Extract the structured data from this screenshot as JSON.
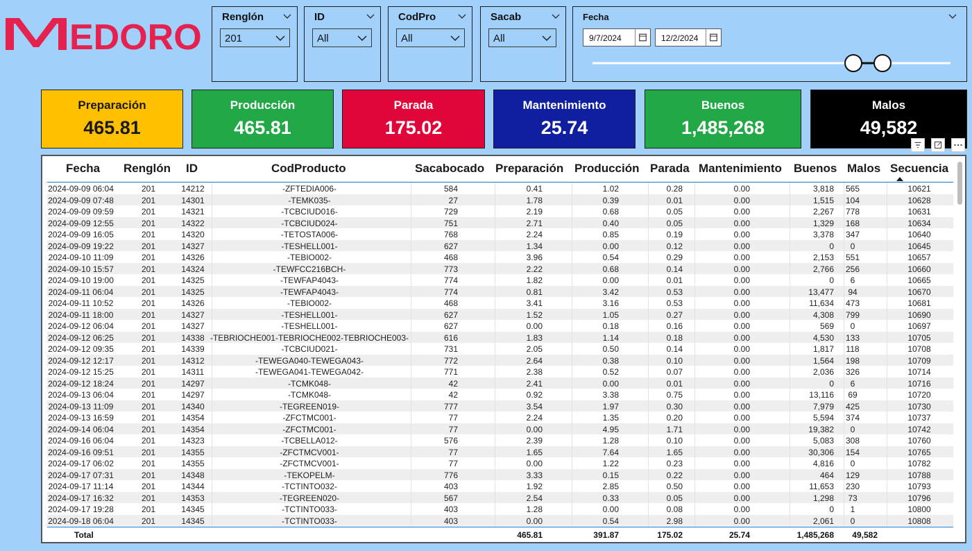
{
  "brand": {
    "logo_text": "MEDORO",
    "logo_color": "#e5224f"
  },
  "slicers": [
    {
      "title": "Renglón",
      "value": "201"
    },
    {
      "title": "ID",
      "value": "All"
    },
    {
      "title": "CodPro",
      "value": "All"
    },
    {
      "title": "Sacab",
      "value": "All"
    }
  ],
  "date_slicer": {
    "title": "Fecha",
    "start": "9/7/2024",
    "end": "12/2/2024"
  },
  "kpis": [
    {
      "label": "Preparación",
      "value": "465.81",
      "bg": "#ffc000",
      "fg": "#1a1a1a"
    },
    {
      "label": "Producción",
      "value": "465.81",
      "bg": "#22a846",
      "fg": "#ffffff"
    },
    {
      "label": "Parada",
      "value": "175.02",
      "bg": "#e0063a",
      "fg": "#ffffff"
    },
    {
      "label": "Mantenimiento",
      "value": "25.74",
      "bg": "#0f1fa0",
      "fg": "#ffffff"
    },
    {
      "label": "Buenos",
      "value": "1,485,268",
      "bg": "#22a846",
      "fg": "#ffffff"
    },
    {
      "label": "Malos",
      "value": "49,582",
      "bg": "#000000",
      "fg": "#ffffff"
    }
  ],
  "table": {
    "headers": [
      "Fecha",
      "Renglón",
      "ID",
      "CodProducto",
      "Sacabocado",
      "Preparación",
      "Producción",
      "Parada",
      "Mantenimiento",
      "Buenos",
      "Malos",
      "Secuencia"
    ],
    "rows": [
      [
        "2024-09-09 06:04",
        "201",
        "14212",
        "-ZFTEDIA006-",
        "584",
        "0.41",
        "1.02",
        "0.28",
        "0.00",
        "3,818",
        "565",
        "10621"
      ],
      [
        "2024-09-09 07:48",
        "201",
        "14301",
        "-TEMK035-",
        "27",
        "1.78",
        "0.39",
        "0.01",
        "0.00",
        "1,515",
        "104",
        "10628"
      ],
      [
        "2024-09-09 09:59",
        "201",
        "14321",
        "-TCBCIUD016-",
        "729",
        "2.19",
        "0.68",
        "0.05",
        "0.00",
        "2,267",
        "778",
        "10631"
      ],
      [
        "2024-09-09 12:55",
        "201",
        "14322",
        "-TCBCIUD024-",
        "751",
        "2.71",
        "0.40",
        "0.05",
        "0.00",
        "1,329",
        "168",
        "10634"
      ],
      [
        "2024-09-09 16:05",
        "201",
        "14320",
        "-TETOSTA006-",
        "768",
        "2.24",
        "0.85",
        "0.19",
        "0.00",
        "3,378",
        "347",
        "10640"
      ],
      [
        "2024-09-09 19:22",
        "201",
        "14327",
        "-TESHELL001-",
        "627",
        "1.34",
        "0.00",
        "0.12",
        "0.00",
        "0",
        "0",
        "10645"
      ],
      [
        "2024-09-10 11:09",
        "201",
        "14326",
        "-TEBIO002-",
        "468",
        "3.96",
        "0.54",
        "0.29",
        "0.00",
        "2,153",
        "551",
        "10657"
      ],
      [
        "2024-09-10 15:57",
        "201",
        "14324",
        "-TEWFCC216BCH-",
        "773",
        "2.22",
        "0.68",
        "0.14",
        "0.00",
        "2,766",
        "256",
        "10660"
      ],
      [
        "2024-09-10 19:00",
        "201",
        "14325",
        "-TEWFAP4043-",
        "774",
        "1.82",
        "0.00",
        "0.01",
        "0.00",
        "0",
        "6",
        "10665"
      ],
      [
        "2024-09-11 06:04",
        "201",
        "14325",
        "-TEWFAP4043-",
        "774",
        "0.81",
        "3.42",
        "0.53",
        "0.00",
        "13,477",
        "94",
        "10670"
      ],
      [
        "2024-09-11 10:52",
        "201",
        "14326",
        "-TEBIO002-",
        "468",
        "3.41",
        "3.16",
        "0.53",
        "0.00",
        "11,634",
        "473",
        "10681"
      ],
      [
        "2024-09-11 18:00",
        "201",
        "14327",
        "-TESHELL001-",
        "627",
        "1.52",
        "1.05",
        "0.27",
        "0.00",
        "4,308",
        "799",
        "10690"
      ],
      [
        "2024-09-12 06:04",
        "201",
        "14327",
        "-TESHELL001-",
        "627",
        "0.00",
        "0.18",
        "0.16",
        "0.00",
        "569",
        "0",
        "10697"
      ],
      [
        "2024-09-12 06:25",
        "201",
        "14338",
        "-TEBRIOCHE001-TEBRIOCHE002-TEBRIOCHE003-",
        "616",
        "1.83",
        "1.14",
        "0.18",
        "0.00",
        "4,530",
        "133",
        "10705"
      ],
      [
        "2024-09-12 09:35",
        "201",
        "14339",
        "-TCBCIUD021-",
        "731",
        "2.05",
        "0.50",
        "0.14",
        "0.00",
        "1,817",
        "118",
        "10708"
      ],
      [
        "2024-09-12 12:17",
        "201",
        "14312",
        "-TEWEGA040-TEWEGA043-",
        "772",
        "2.64",
        "0.38",
        "0.10",
        "0.00",
        "1,564",
        "198",
        "10709"
      ],
      [
        "2024-09-12 15:25",
        "201",
        "14311",
        "-TEWEGA041-TEWEGA042-",
        "771",
        "2.38",
        "0.52",
        "0.07",
        "0.00",
        "2,036",
        "326",
        "10714"
      ],
      [
        "2024-09-12 18:24",
        "201",
        "14297",
        "-TCMK048-",
        "42",
        "2.41",
        "0.00",
        "0.01",
        "0.00",
        "0",
        "6",
        "10716"
      ],
      [
        "2024-09-13 06:04",
        "201",
        "14297",
        "-TCMK048-",
        "42",
        "0.92",
        "3.38",
        "0.75",
        "0.00",
        "13,116",
        "69",
        "10720"
      ],
      [
        "2024-09-13 11:09",
        "201",
        "14340",
        "-TEGREEN019-",
        "777",
        "3.54",
        "1.97",
        "0.30",
        "0.00",
        "7,979",
        "425",
        "10730"
      ],
      [
        "2024-09-13 16:59",
        "201",
        "14354",
        "-ZFCTMC001-",
        "77",
        "2.24",
        "1.35",
        "0.20",
        "0.00",
        "5,594",
        "374",
        "10737"
      ],
      [
        "2024-09-14 06:04",
        "201",
        "14354",
        "-ZFCTMC001-",
        "77",
        "0.00",
        "4.95",
        "1.71",
        "0.00",
        "19,382",
        "0",
        "10742"
      ],
      [
        "2024-09-16 06:04",
        "201",
        "14323",
        "-TCBELLA012-",
        "576",
        "2.39",
        "1.28",
        "0.10",
        "0.00",
        "5,083",
        "308",
        "10760"
      ],
      [
        "2024-09-16 09:51",
        "201",
        "14355",
        "-ZFCTMCV001-",
        "77",
        "1.65",
        "7.64",
        "1.65",
        "0.00",
        "30,306",
        "154",
        "10765"
      ],
      [
        "2024-09-17 06:02",
        "201",
        "14355",
        "-ZFCTMCV001-",
        "77",
        "0.00",
        "1.22",
        "0.23",
        "0.00",
        "4,816",
        "0",
        "10782"
      ],
      [
        "2024-09-17 07:31",
        "201",
        "14348",
        "-TEKOPELM-",
        "776",
        "3.33",
        "0.15",
        "0.22",
        "0.00",
        "464",
        "129",
        "10788"
      ],
      [
        "2024-09-17 11:14",
        "201",
        "14344",
        "-TCTINTO032-",
        "403",
        "1.92",
        "2.85",
        "0.50",
        "0.00",
        "11,653",
        "230",
        "10793"
      ],
      [
        "2024-09-17 16:32",
        "201",
        "14353",
        "-TEGREEN020-",
        "567",
        "2.54",
        "0.33",
        "0.05",
        "0.00",
        "1,298",
        "73",
        "10796"
      ],
      [
        "2024-09-17 19:28",
        "201",
        "14345",
        "-TCTINTO033-",
        "403",
        "1.28",
        "0.00",
        "0.08",
        "0.00",
        "0",
        "1",
        "10800"
      ],
      [
        "2024-09-18 06:04",
        "201",
        "14345",
        "-TCTINTO033-",
        "403",
        "0.00",
        "0.54",
        "2.98",
        "0.00",
        "2,061",
        "0",
        "10808"
      ]
    ],
    "total": {
      "label": "Total",
      "preparacion": "465.81",
      "produccion": "391.87",
      "parada": "175.02",
      "mantenimiento": "25.74",
      "buenos": "1,485,268",
      "malos": "49,582"
    }
  }
}
